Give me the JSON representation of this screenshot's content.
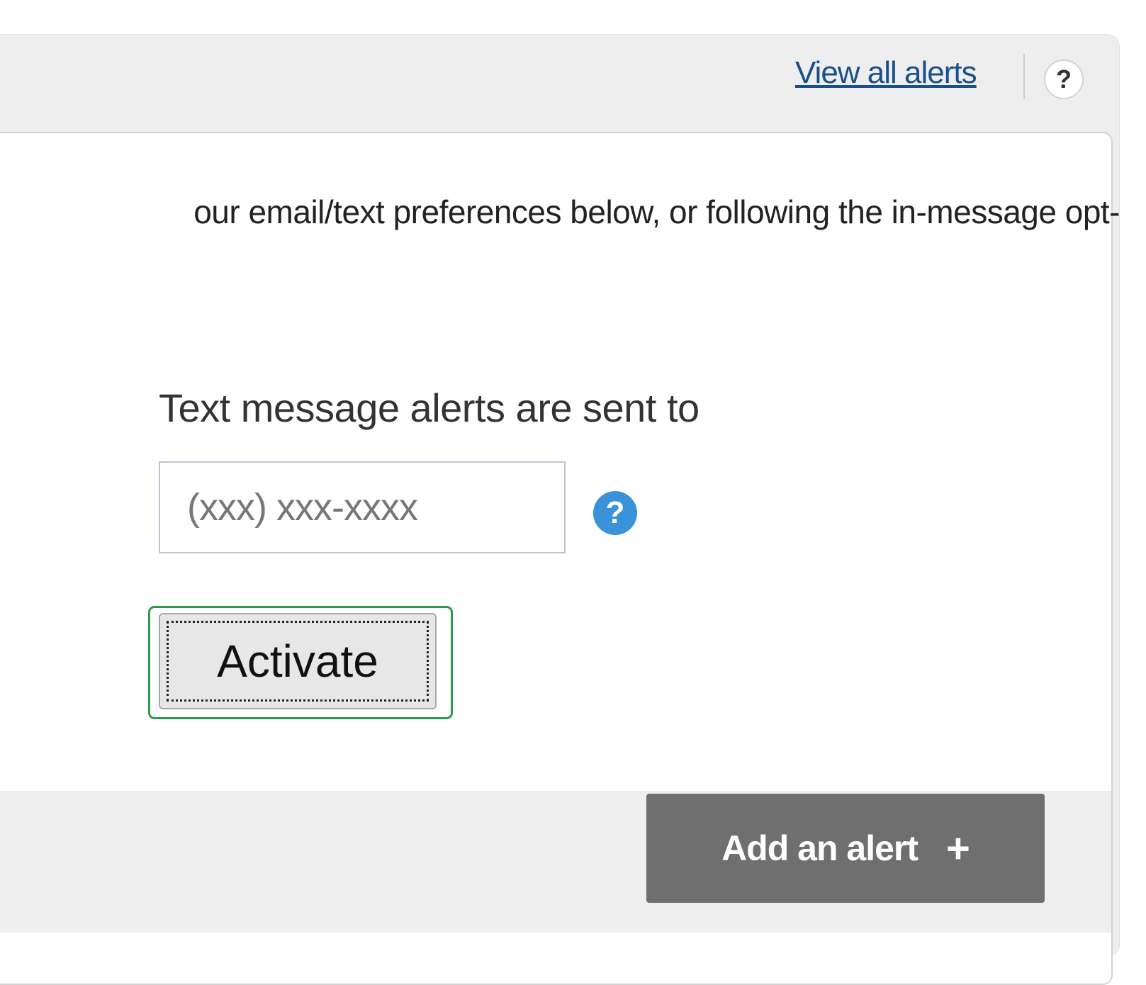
{
  "header": {
    "view_all_alerts_label": "View all alerts",
    "help_icon": "question-mark-icon",
    "help_glyph": "?"
  },
  "content": {
    "info_text": "our email/text preferences below, or following the in-message opt-",
    "sms_label": "Text message alerts are sent to",
    "phone_input": {
      "placeholder": "(xxx) xxx-xxxx",
      "value": ""
    },
    "phone_help_icon": "question-mark-icon",
    "phone_help_glyph": "?",
    "activate_label": "Activate"
  },
  "footer": {
    "add_alert_label": "Add an alert",
    "add_alert_icon": "plus-icon",
    "add_alert_glyph": "+"
  },
  "colors": {
    "link": "#1a4f8c",
    "help_blue": "#3a92d8",
    "focus_green": "#2e9a4f",
    "add_button_bg": "#6f6f6f"
  }
}
